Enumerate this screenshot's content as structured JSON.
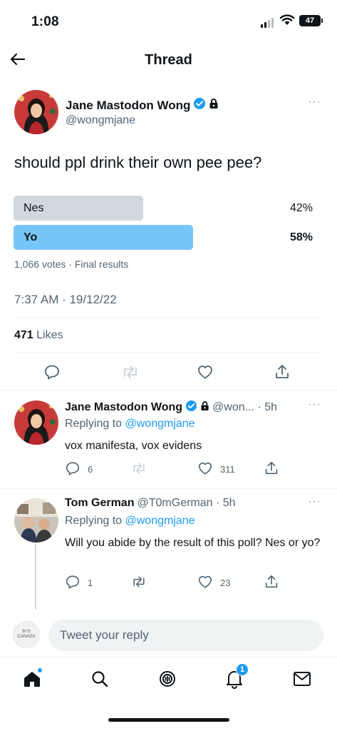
{
  "status_bar": {
    "time": "1:08",
    "battery": "47"
  },
  "nav": {
    "title": "Thread"
  },
  "main_tweet": {
    "author_name": "Jane Mastodon Wong",
    "handle": "@wongmjane",
    "text": "should ppl drink their own pee pee?",
    "poll": {
      "options": [
        {
          "label": "Nes",
          "percent_text": "42%",
          "percent": 42,
          "winner": false
        },
        {
          "label": "Yo",
          "percent_text": "58%",
          "percent": 58,
          "winner": true
        }
      ],
      "meta": "1,066 votes · Final results"
    },
    "timestamp": "7:37 AM · 19/12/22",
    "likes_count": "471",
    "likes_label": "Likes"
  },
  "replies": [
    {
      "author_name": "Jane Mastodon Wong",
      "handle_time": "@won... · 5h",
      "replying_to_prefix": "Replying to",
      "replying_to": "@wongmjane",
      "text": "vox manifesta, vox evidens",
      "reply_count": "6",
      "retweet_count": "",
      "like_count": "311"
    },
    {
      "author_name": "Tom German",
      "handle_time": "@T0mGerman · 5h",
      "replying_to_prefix": "Replying to",
      "replying_to": "@wongmjane",
      "text": "Will you abide by the result of this poll? Nes or yo?",
      "reply_count": "1",
      "retweet_count": "",
      "like_count": "23"
    }
  ],
  "composer": {
    "placeholder": "Tweet your reply",
    "avatar_text": "B+S CANADA"
  },
  "tabbar": {
    "notifications_badge": "1"
  },
  "colors": {
    "accent": "#1d9bf0",
    "poll_winner": "#78c6f7",
    "poll_loser": "#cfd9de",
    "text": "#0f1419",
    "muted": "#536471"
  },
  "icons": [
    "back-arrow-icon",
    "verified-badge-icon",
    "lock-icon",
    "more-icon",
    "reply-icon",
    "retweet-icon",
    "like-icon",
    "share-icon",
    "home-icon",
    "search-icon",
    "spaces-icon",
    "notifications-icon",
    "messages-icon"
  ]
}
